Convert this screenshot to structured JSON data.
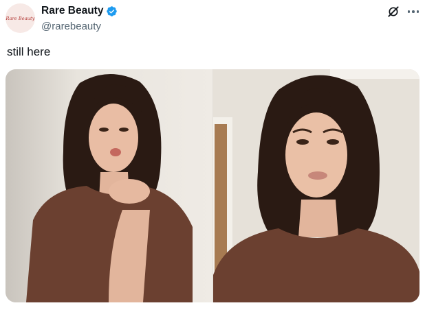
{
  "account": {
    "avatar_text": "Rare Beauty",
    "display_name": "Rare Beauty",
    "handle": "@rarebeauty",
    "verified": true,
    "verified_color": "#1d9bf0"
  },
  "header_actions": {
    "grok_icon": "grok-icon",
    "more_icon": "more-icon"
  },
  "tweet": {
    "text": "still here"
  },
  "media": {
    "count": 2,
    "photos": [
      {
        "subject": "woman with bob haircut in brown top blowing a kiss"
      },
      {
        "subject": "woman with bob haircut in brown top selfie"
      }
    ]
  },
  "colors": {
    "text_primary": "#0f1419",
    "text_secondary": "#536471",
    "accent": "#1d9bf0",
    "shirt": "#6b4030",
    "hair": "#2a1a13"
  }
}
